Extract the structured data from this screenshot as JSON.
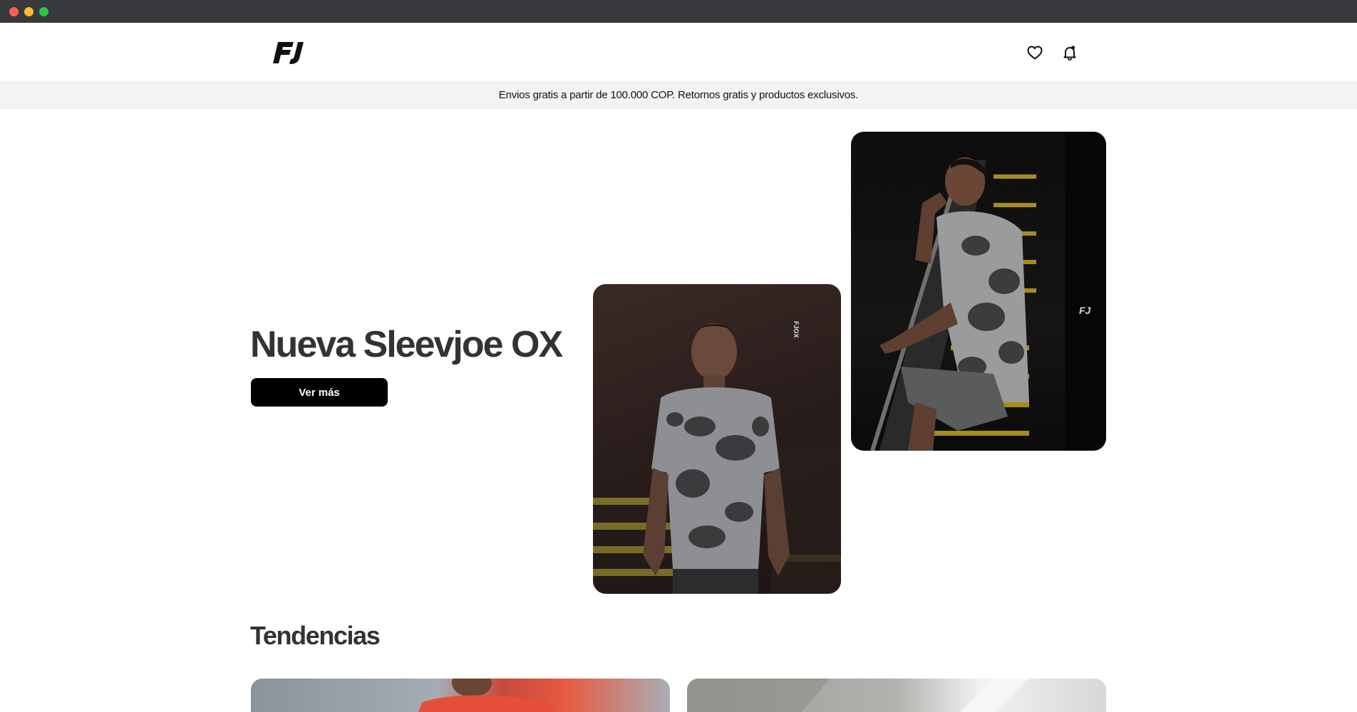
{
  "header": {
    "logo_text": "FJ",
    "favorites_icon": "heart-icon",
    "notifications_icon": "bell-icon"
  },
  "announcement": {
    "text": "Envios gratis a partir de 100.000 COP. Retornos gratis y productos exclusivos."
  },
  "hero": {
    "title": "Nueva Sleevjoe OX",
    "cta_label": "Ver más",
    "photo_1_print": "FJOX",
    "photo_2_logo": "FJ"
  },
  "trends": {
    "title": "Tendencias"
  },
  "colors": {
    "primary": "#000000",
    "heading": "#333333",
    "announcement_bg": "#f3f3f3"
  }
}
